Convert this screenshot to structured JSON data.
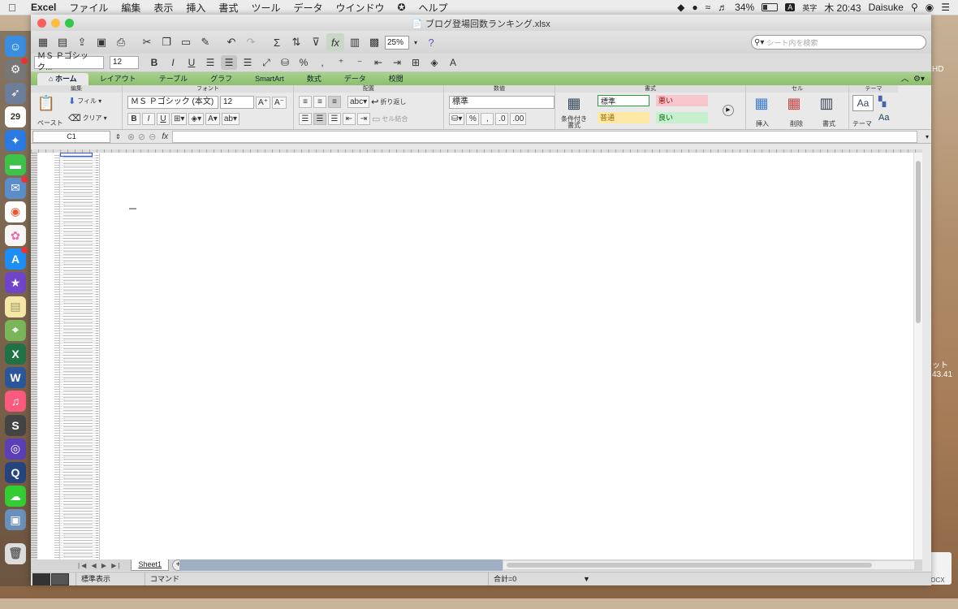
{
  "menubar": {
    "apple": "",
    "app": "Excel",
    "items": [
      "ファイル",
      "編集",
      "表示",
      "挿入",
      "書式",
      "ツール",
      "データ",
      "ウインドウ",
      "ヘルプ"
    ],
    "battery": "34%",
    "input_mode": "英字",
    "input_badge": "A",
    "clock": "木 20:43",
    "user": "Daisuke"
  },
  "window": {
    "title": "ブログ登場回数ランキング.xlsx",
    "zoom": "25%",
    "search_placeholder": "シート内を検索"
  },
  "formatbar": {
    "font": "ＭＳ Ｐゴシック...",
    "size": "12"
  },
  "ribbon_tabs": [
    "ホーム",
    "レイアウト",
    "テーブル",
    "グラフ",
    "SmartArt",
    "数式",
    "データ",
    "校閲"
  ],
  "ribbon": {
    "groups": {
      "edit": "編集",
      "font": "フォント",
      "align": "配置",
      "number": "数値",
      "style": "書式",
      "cell": "セル",
      "theme": "テーマ"
    },
    "paste": "ペースト",
    "fill": "フィル",
    "clear": "クリア",
    "font_name": "ＭＳ Ｐゴシック (本文)",
    "font_size": "12",
    "wrap": "折り返し",
    "merge": "セル結合",
    "number_format": "標準",
    "conditional": "条件付き書式",
    "styles": {
      "normal": "標準",
      "bad": "悪い",
      "neutral": "普通",
      "good": "良い"
    },
    "insert": "挿入",
    "delete": "削除",
    "format": "書式",
    "theme": "テーマ"
  },
  "formula": {
    "name_box": "C1",
    "fx": "fx"
  },
  "sheet": {
    "tabs": [
      "Sheet1"
    ],
    "add": "+"
  },
  "status": {
    "view": "標準表示",
    "mode": "コマンド",
    "sum": "合計=0"
  },
  "desktop": {
    "right_label1": "HD",
    "right_label2": "ット",
    "right_label3": "43.41",
    "docx": "DOCX"
  }
}
